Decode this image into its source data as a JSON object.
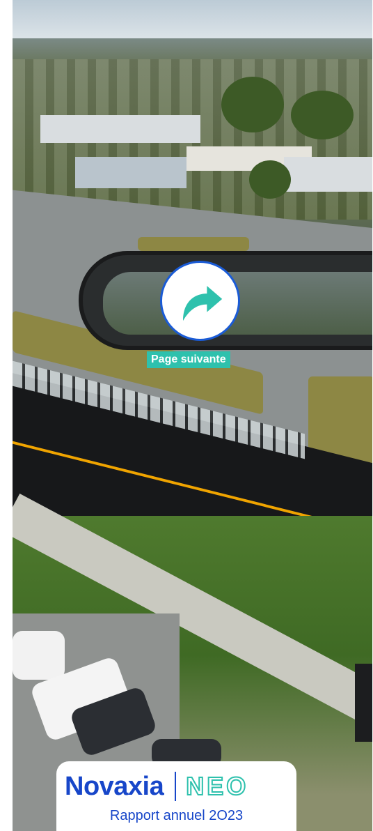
{
  "next_page": {
    "label": "Page suivante",
    "icon": "curved-arrow-right-icon"
  },
  "logo": {
    "brand": "Novaxia",
    "product": "NEO",
    "subtitle": "Rapport annuel 2O23"
  },
  "colors": {
    "brand_blue": "#1746c9",
    "accent_teal": "#2ec1ad",
    "button_border": "#1a5bd6"
  }
}
